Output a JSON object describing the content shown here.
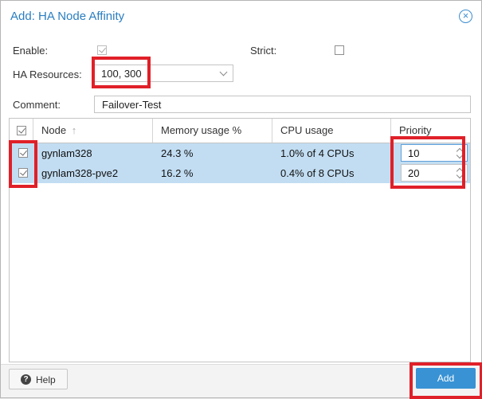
{
  "dialog": {
    "title": "Add: HA Node Affinity",
    "close_icon": "close-circle-icon"
  },
  "form": {
    "enable_label": "Enable:",
    "enable_checked": true,
    "strict_label": "Strict:",
    "strict_checked": false,
    "ha_resources_label": "HA Resources:",
    "ha_resources_value": "100, 300",
    "comment_label": "Comment:",
    "comment_value": "Failover-Test"
  },
  "grid": {
    "columns": {
      "node": "Node",
      "memory": "Memory usage %",
      "cpu": "CPU usage",
      "priority": "Priority"
    },
    "sort_icon": "sort-ascending-arrow-icon",
    "rows": [
      {
        "checked": true,
        "node": "gynlam328",
        "memory": "24.3 %",
        "cpu": "1.0% of 4 CPUs",
        "priority": "10"
      },
      {
        "checked": true,
        "node": "gynlam328-pve2",
        "memory": "16.2 %",
        "cpu": "0.4% of 8 CPUs",
        "priority": "20"
      }
    ]
  },
  "footer": {
    "help_label": "Help",
    "help_icon": "question-circle-icon",
    "add_label": "Add"
  },
  "colors": {
    "accent": "#3892d4",
    "title": "#2a7ec0",
    "row_selected": "#c2ddf2",
    "highlight": "#e02028"
  }
}
